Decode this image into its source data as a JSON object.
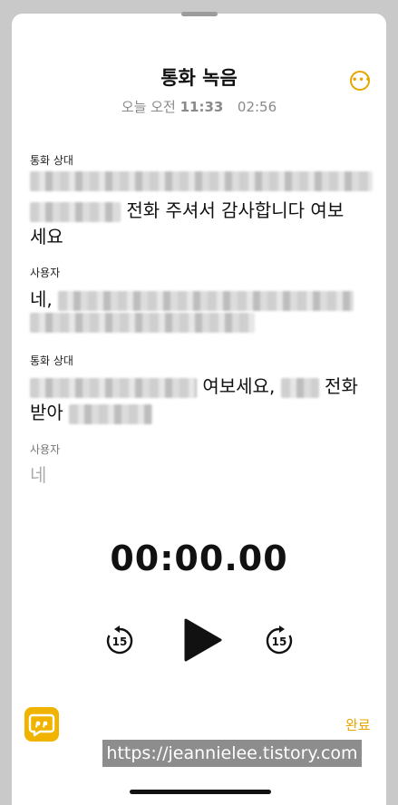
{
  "header": {
    "title": "통화 녹음",
    "date_label": "오늘 오전",
    "time": "11:33",
    "duration": "02:56"
  },
  "transcript": [
    {
      "speaker": "통화 상대",
      "line1_text": "",
      "line2_text": "전화 주셔서 감사합니다 여보",
      "line3_text": "세요"
    },
    {
      "speaker": "사용자",
      "line1_text": "네,"
    },
    {
      "speaker": "통화 상대",
      "line1_text": "여보세요,",
      "line1_tail": "전화",
      "line2_text": "받아"
    },
    {
      "speaker": "사용자",
      "line1_text": "네"
    }
  ],
  "player": {
    "elapsed": "00:00.00",
    "skip_back_label": "15",
    "skip_forward_label": "15"
  },
  "footer": {
    "done_label": "완료",
    "watermark": "https://jeannielee.tistory.com"
  },
  "colors": {
    "accent": "#e7a500",
    "chat_button": "#f0b400"
  },
  "icons": [
    "more-icon",
    "skip-back-15-icon",
    "play-icon",
    "skip-forward-15-icon",
    "quote-chat-icon"
  ]
}
